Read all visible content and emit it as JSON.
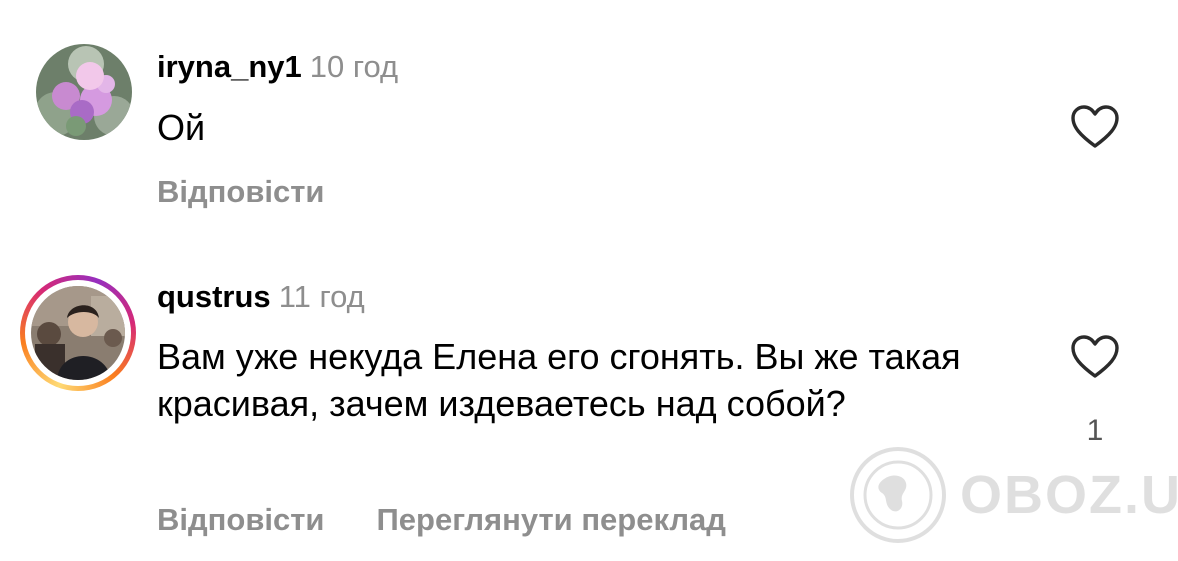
{
  "comments": [
    {
      "username": "iryna_ny1",
      "time": "10 год",
      "text": "Ой",
      "reply_label": "Відповісти"
    },
    {
      "username": "qustrus",
      "time": "11 год",
      "text": "Вам уже некуда Елена его сгонять. Вы же такая красивая, зачем издеваетесь над собой?",
      "like_count": "1",
      "reply_label": "Відповісти",
      "translate_label": "Переглянути переклад"
    }
  ],
  "watermark": {
    "text": "OBOZ.UA"
  },
  "icons": [
    "heart-outline-icon",
    "globe-icon"
  ],
  "colors": {
    "secondary_text": "#8e8e8e",
    "story_ring_start": "#feda75",
    "story_ring_mid": "#d62976",
    "story_ring_end": "#962fbf"
  }
}
